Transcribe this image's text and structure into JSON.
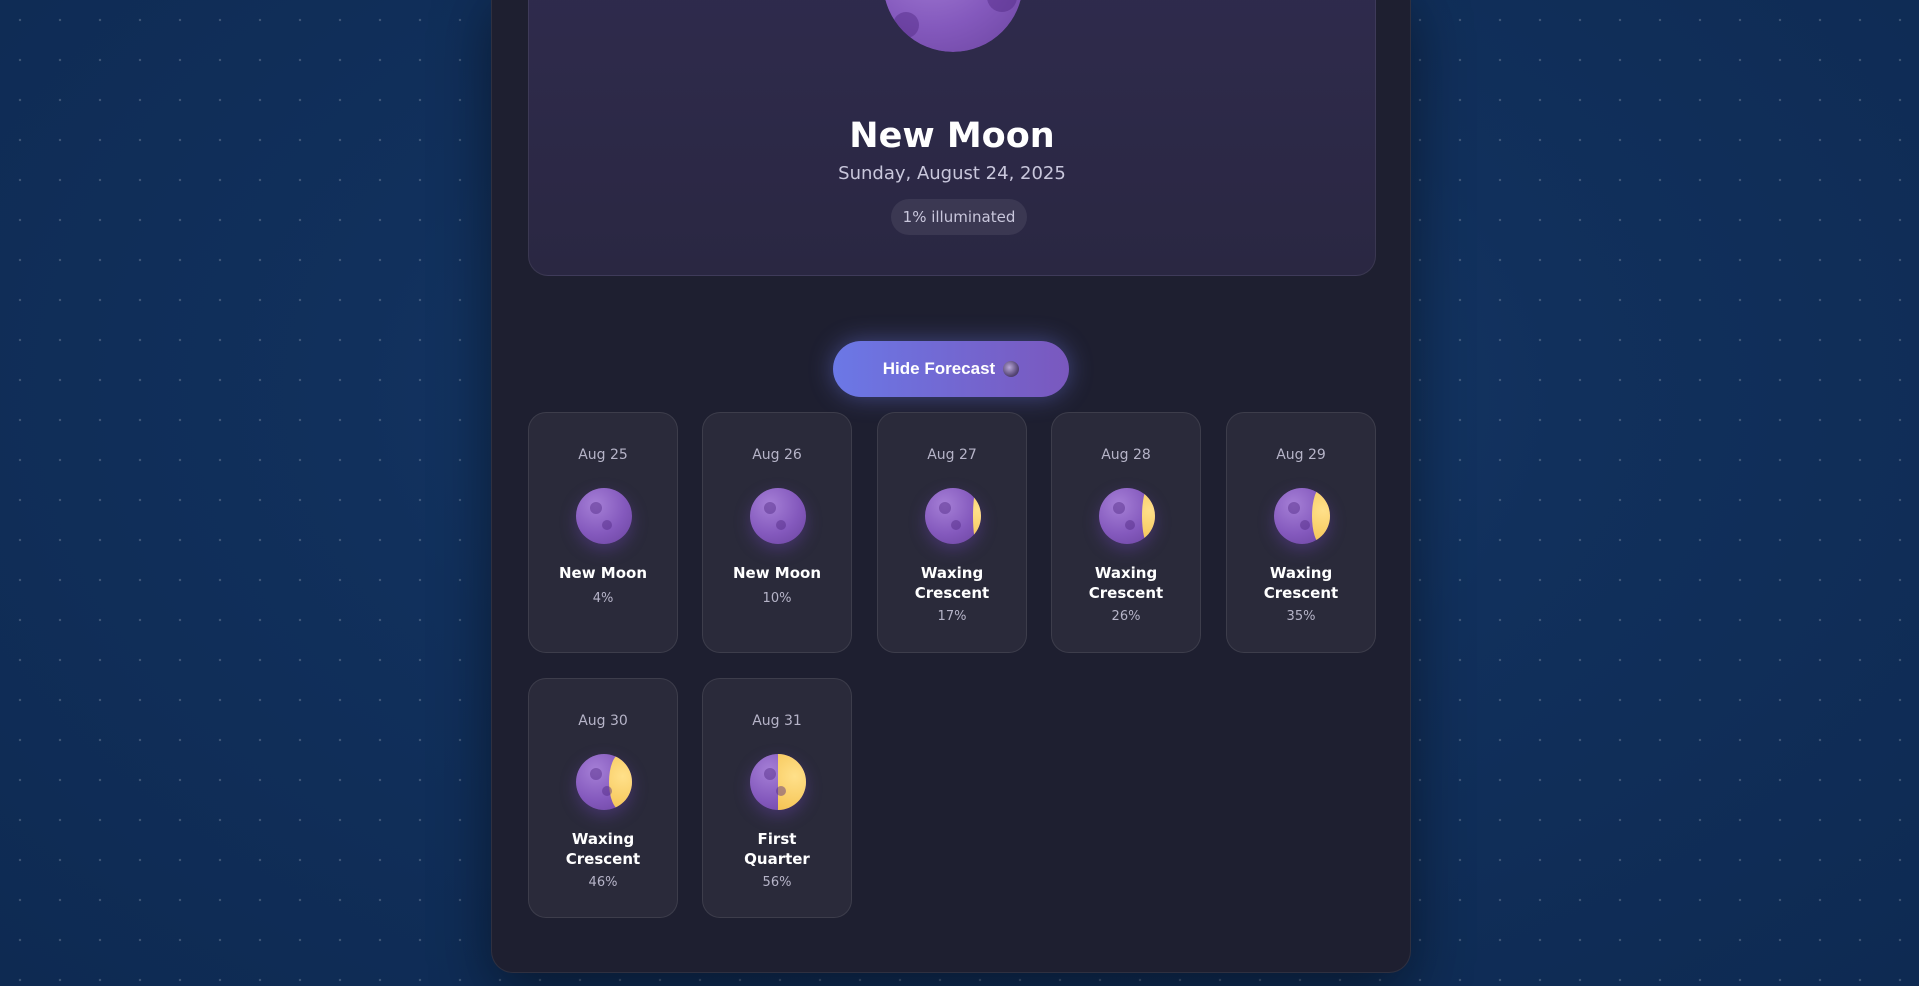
{
  "hero": {
    "phase_name": "New Moon",
    "date": "Sunday, August 24, 2025",
    "illumination": "1% illuminated"
  },
  "toggle_button": {
    "label": "Hide Forecast",
    "icon": "moon-emoji-icon"
  },
  "forecast": [
    {
      "date": "Aug 25",
      "phase": "New Moon",
      "illumination": "4%",
      "illumination_fraction": 0.04
    },
    {
      "date": "Aug 26",
      "phase": "New Moon",
      "illumination": "10%",
      "illumination_fraction": 0.1
    },
    {
      "date": "Aug 27",
      "phase": "Waxing Crescent",
      "illumination": "17%",
      "illumination_fraction": 0.17
    },
    {
      "date": "Aug 28",
      "phase": "Waxing Crescent",
      "illumination": "26%",
      "illumination_fraction": 0.26
    },
    {
      "date": "Aug 29",
      "phase": "Waxing Crescent",
      "illumination": "35%",
      "illumination_fraction": 0.35
    },
    {
      "date": "Aug 30",
      "phase": "Waxing Crescent",
      "illumination": "46%",
      "illumination_fraction": 0.46
    },
    {
      "date": "Aug 31",
      "phase": "First Quarter",
      "illumination": "56%",
      "illumination_fraction": 0.56
    }
  ],
  "colors": {
    "moon_dark": "#8459bd",
    "moon_lit": "#f5c453",
    "button_start": "#6b78e6",
    "button_end": "#7a58be"
  }
}
